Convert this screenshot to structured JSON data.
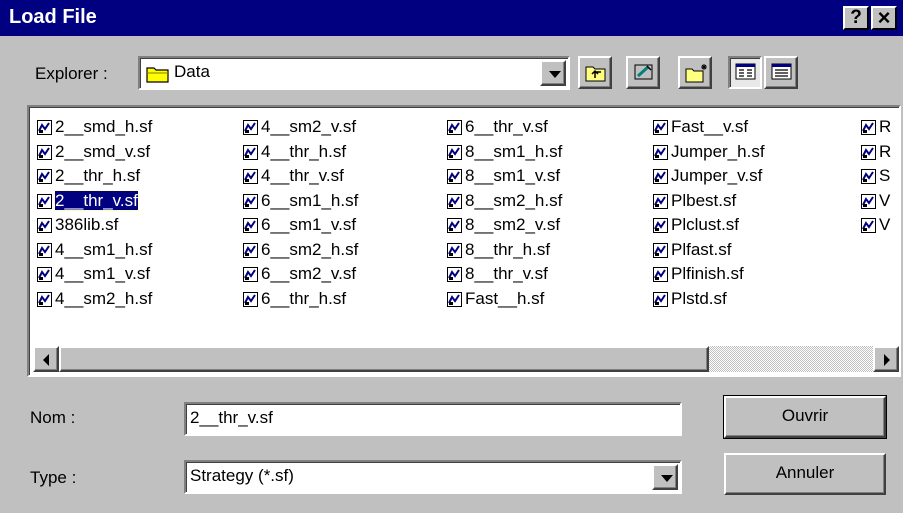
{
  "window": {
    "title": "Load File",
    "help_label": "?",
    "close_label": "×"
  },
  "explorer": {
    "label": "Explorer :",
    "folder": "Data",
    "folder_icon": "folder-icon"
  },
  "toolbar": {
    "icons": [
      "up-folder-icon",
      "desktop-icon",
      "new-folder-icon",
      "list-view-icon",
      "details-view-icon"
    ]
  },
  "files": {
    "columns": [
      [
        "2__smd_h.sf",
        "2__smd_v.sf",
        "2__thr_h.sf",
        "2__thr_v.sf",
        "386lib.sf",
        "4__sm1_h.sf",
        "4__sm1_v.sf",
        "4__sm2_h.sf"
      ],
      [
        "4__sm2_v.sf",
        "4__thr_h.sf",
        "4__thr_v.sf",
        "6__sm1_h.sf",
        "6__sm1_v.sf",
        "6__sm2_h.sf",
        "6__sm2_v.sf",
        "6__thr_h.sf"
      ],
      [
        "6__thr_v.sf",
        "8__sm1_h.sf",
        "8__sm1_v.sf",
        "8__sm2_h.sf",
        "8__sm2_v.sf",
        "8__thr_h.sf",
        "8__thr_v.sf",
        "Fast__h.sf"
      ],
      [
        "Fast__v.sf",
        "Jumper_h.sf",
        "Jumper_v.sf",
        "Plbest.sf",
        "Plclust.sf",
        "Plfast.sf",
        "Plfinish.sf",
        "Plstd.sf"
      ],
      [
        "R",
        "R",
        "S",
        "V",
        "V"
      ]
    ],
    "selected": "2__thr_v.sf",
    "file_icon": "strategy-file-icon"
  },
  "form": {
    "name_label": "Nom :",
    "name_value": "2__thr_v.sf",
    "type_label": "Type :",
    "type_value": "Strategy (*.sf)"
  },
  "buttons": {
    "open": "Ouvrir",
    "cancel": "Annuler"
  }
}
